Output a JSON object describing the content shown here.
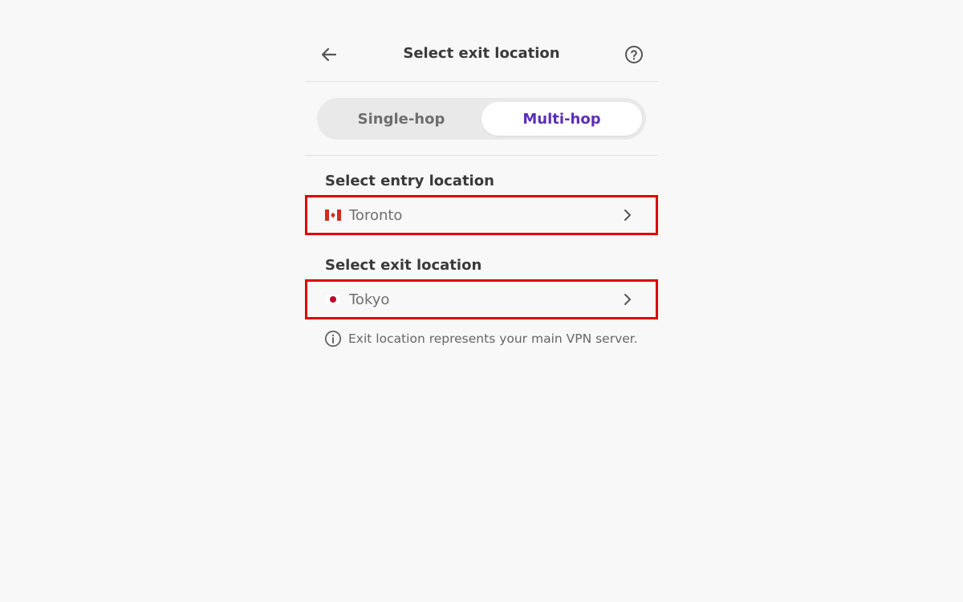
{
  "header": {
    "back_icon": "arrow-left-icon",
    "title": "Select exit location",
    "help_icon": "question-circle-icon"
  },
  "tabs": {
    "items": [
      {
        "label": "Single-hop",
        "active": false
      },
      {
        "label": "Multi-hop",
        "active": true
      }
    ]
  },
  "entry": {
    "label": "Select entry location",
    "location": "Toronto",
    "flag": "canada-flag-icon"
  },
  "exit": {
    "label": "Select exit location",
    "location": "Tokyo",
    "flag": "japan-flag-icon"
  },
  "note": {
    "icon": "info-circle-icon",
    "text": "Exit location represents your main VPN server."
  },
  "colors": {
    "accent": "#5b2fb8",
    "highlight_border": "#e00000",
    "background": "#f8f8f8"
  }
}
